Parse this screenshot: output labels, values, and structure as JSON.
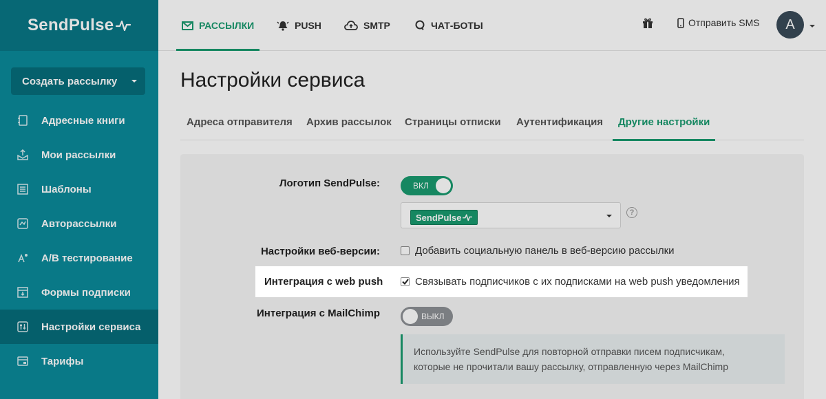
{
  "brand": {
    "name": "SendPulse",
    "color": "#1a9a6f",
    "sidebar_color": "#0b8a9a"
  },
  "sidebar": {
    "create_button": "Создать рассылку",
    "items": [
      {
        "label": "Адресные книги",
        "icon": "address-book-icon"
      },
      {
        "label": "Мои рассылки",
        "icon": "mailing-icon"
      },
      {
        "label": "Шаблоны",
        "icon": "templates-icon"
      },
      {
        "label": "Авторассылки",
        "icon": "automation-icon"
      },
      {
        "label": "A/B тестирование",
        "icon": "ab-test-icon"
      },
      {
        "label": "Формы подписки",
        "icon": "forms-icon"
      },
      {
        "label": "Настройки сервиса",
        "icon": "settings-icon",
        "active": true
      },
      {
        "label": "Тарифы",
        "icon": "pricing-icon"
      }
    ]
  },
  "topnav": {
    "items": [
      {
        "label": "РАССЫЛКИ",
        "icon": "mail-icon",
        "active": true
      },
      {
        "label": "PUSH",
        "icon": "bell-icon"
      },
      {
        "label": "SMTP",
        "icon": "cloud-icon"
      },
      {
        "label": "ЧАТ-БОТЫ",
        "icon": "chat-icon"
      }
    ],
    "gift_icon": "gift-icon",
    "sms_label": "Отправить SMS",
    "avatar_letter": "A"
  },
  "page": {
    "title": "Настройки сервиса",
    "tabs": [
      {
        "label": "Адреса отправителя"
      },
      {
        "label": "Архив рассылок"
      },
      {
        "label": "Страницы отписки"
      },
      {
        "label": "Аутентификация"
      },
      {
        "label": "Другие настройки",
        "active": true
      }
    ]
  },
  "settings": {
    "logo": {
      "label": "Логотип SendPulse:",
      "toggle": "ВКЛ",
      "selected_logo": "SendPulse",
      "help": "?"
    },
    "web_version": {
      "label": "Настройки веб-версии:",
      "checkbox": "Добавить социальную панель в веб-версию рассылки",
      "checked": false
    },
    "web_push": {
      "label": "Интеграция с web push",
      "checkbox": "Связывать подписчиков с их подписками на web push уведомления",
      "checked": true
    },
    "mailchimp": {
      "label": "Интеграция с MailChimp",
      "toggle": "ВЫКЛ",
      "info_line1": "Используйте SendPulse для повторной отправки писем подписчикам,",
      "info_line2": "которые не прочитали вашу рассылку, отправленную через MailChimp"
    }
  }
}
